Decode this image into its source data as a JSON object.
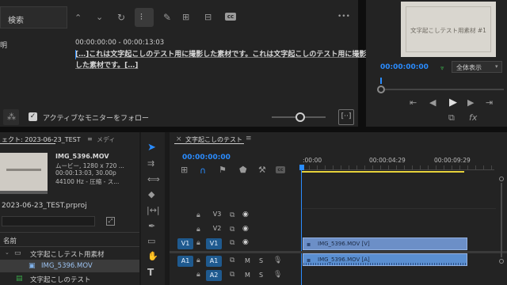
{
  "text_panel": {
    "search_label": "検索",
    "description_label": "明",
    "timecode_range": "00:00:00:00 - 00:00:13:03",
    "transcript_line1": "[…]これは文字起こしのテスト用に撮影した素材です。これは文字起こしのテスト用に撮影",
    "transcript_line2": "した素材です。[…]",
    "follow_monitor_label": "アクティブなモニターをフォロー",
    "cc_badge": "cc",
    "menu_dots": "•••"
  },
  "monitor": {
    "frame_text": "文字起こしテスト用素材 #1",
    "timecode": "00:00:00:00",
    "fit_label": "全体表示"
  },
  "project": {
    "tab_title": "ェクト: 2023-06-23_TEST",
    "tab_media": "メディ",
    "clip_name": "IMG_5396.MOV",
    "clip_info1": "ムービー, 1280 x 720 ...",
    "clip_info2": "00:00:13:03, 30.00p",
    "clip_info3": "44100 Hz - 圧縮 - ス...",
    "project_file": "2023-06-23_TEST.prproj",
    "col_name": "名前",
    "items": [
      {
        "name": "文字起こしテスト用素材"
      },
      {
        "name": "IMG_5396.MOV"
      },
      {
        "name": "文字起こしのテスト"
      }
    ]
  },
  "timeline": {
    "tab_title": "文字起こしのテスト",
    "timecode": "00:00:00:00",
    "ruler": [
      ":00:00",
      "00:00:04:29",
      "00:00:09:29"
    ],
    "tracks": [
      {
        "label": "V3"
      },
      {
        "label": "V2"
      },
      {
        "label": "V1",
        "src": "V1"
      },
      {
        "label": "A1",
        "src": "A1"
      },
      {
        "label": "A2"
      }
    ],
    "video_clip": "IMG_5396.MOV [V]",
    "audio_clip": "IMG_5396.MOV [A]",
    "m_label": "M",
    "s_label": "S"
  },
  "colors": {
    "accent": "#2a8cff",
    "clip_video": "#6c8fc7",
    "track_on": "#1f5a8f",
    "playhead": "#2a8cff"
  }
}
